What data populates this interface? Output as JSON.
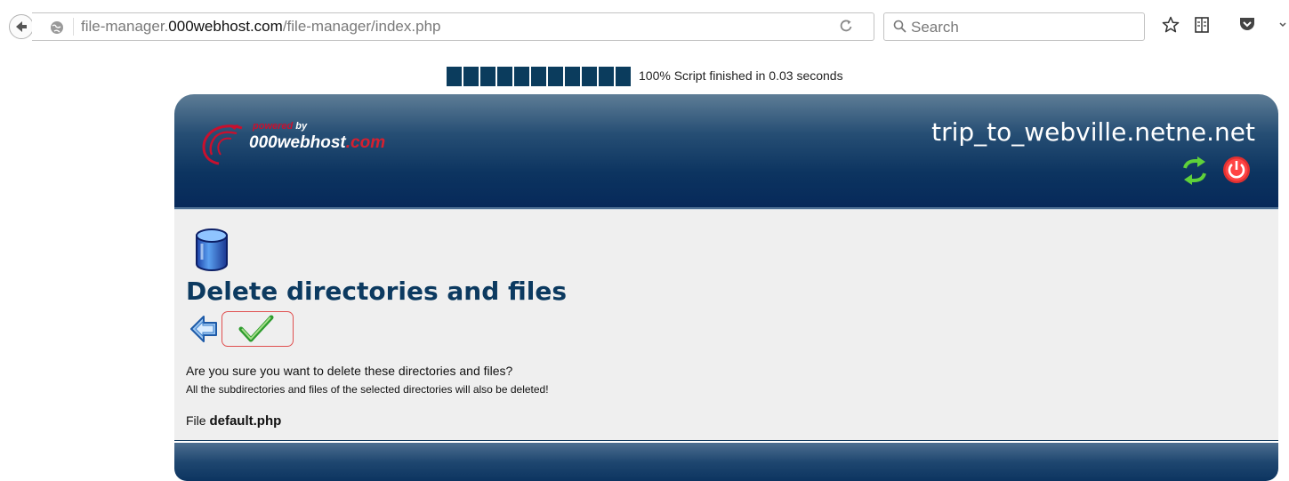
{
  "browser": {
    "url_prefix": "file-manager.",
    "url_host": "000webhost.com",
    "url_path": "/file-manager/index.php",
    "search_placeholder": "Search"
  },
  "progress": {
    "percent": 100,
    "segments": 11,
    "text": "100% Script finished in 0.03 seconds"
  },
  "header": {
    "logo_powered": "powered",
    "logo_by": "by",
    "logo_name": "000webhost",
    "logo_domain": ".com",
    "site_name": "trip_to_webville.netne.net"
  },
  "main": {
    "title": "Delete directories and files",
    "question": "Are you sure you want to delete these directories and files?",
    "warning": "All the subdirectories and files of the selected directories will also be deleted!",
    "file_label": "File",
    "file_name": "default.php"
  },
  "colors": {
    "accent": "#0c3a60",
    "header_dark": "#07295a",
    "progress": "#0b3c5d",
    "confirm_border": "#e05050"
  }
}
